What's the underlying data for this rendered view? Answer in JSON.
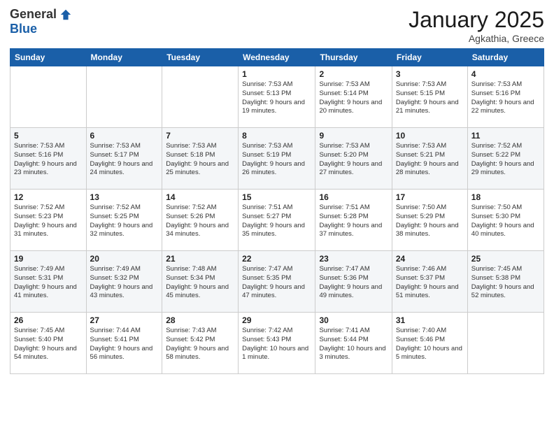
{
  "header": {
    "logo_general": "General",
    "logo_blue": "Blue",
    "month": "January 2025",
    "location": "Agkathia, Greece"
  },
  "weekdays": [
    "Sunday",
    "Monday",
    "Tuesday",
    "Wednesday",
    "Thursday",
    "Friday",
    "Saturday"
  ],
  "weeks": [
    [
      {
        "day": "",
        "detail": ""
      },
      {
        "day": "",
        "detail": ""
      },
      {
        "day": "",
        "detail": ""
      },
      {
        "day": "1",
        "detail": "Sunrise: 7:53 AM\nSunset: 5:13 PM\nDaylight: 9 hours\nand 19 minutes."
      },
      {
        "day": "2",
        "detail": "Sunrise: 7:53 AM\nSunset: 5:14 PM\nDaylight: 9 hours\nand 20 minutes."
      },
      {
        "day": "3",
        "detail": "Sunrise: 7:53 AM\nSunset: 5:15 PM\nDaylight: 9 hours\nand 21 minutes."
      },
      {
        "day": "4",
        "detail": "Sunrise: 7:53 AM\nSunset: 5:16 PM\nDaylight: 9 hours\nand 22 minutes."
      }
    ],
    [
      {
        "day": "5",
        "detail": "Sunrise: 7:53 AM\nSunset: 5:16 PM\nDaylight: 9 hours\nand 23 minutes."
      },
      {
        "day": "6",
        "detail": "Sunrise: 7:53 AM\nSunset: 5:17 PM\nDaylight: 9 hours\nand 24 minutes."
      },
      {
        "day": "7",
        "detail": "Sunrise: 7:53 AM\nSunset: 5:18 PM\nDaylight: 9 hours\nand 25 minutes."
      },
      {
        "day": "8",
        "detail": "Sunrise: 7:53 AM\nSunset: 5:19 PM\nDaylight: 9 hours\nand 26 minutes."
      },
      {
        "day": "9",
        "detail": "Sunrise: 7:53 AM\nSunset: 5:20 PM\nDaylight: 9 hours\nand 27 minutes."
      },
      {
        "day": "10",
        "detail": "Sunrise: 7:53 AM\nSunset: 5:21 PM\nDaylight: 9 hours\nand 28 minutes."
      },
      {
        "day": "11",
        "detail": "Sunrise: 7:52 AM\nSunset: 5:22 PM\nDaylight: 9 hours\nand 29 minutes."
      }
    ],
    [
      {
        "day": "12",
        "detail": "Sunrise: 7:52 AM\nSunset: 5:23 PM\nDaylight: 9 hours\nand 31 minutes."
      },
      {
        "day": "13",
        "detail": "Sunrise: 7:52 AM\nSunset: 5:25 PM\nDaylight: 9 hours\nand 32 minutes."
      },
      {
        "day": "14",
        "detail": "Sunrise: 7:52 AM\nSunset: 5:26 PM\nDaylight: 9 hours\nand 34 minutes."
      },
      {
        "day": "15",
        "detail": "Sunrise: 7:51 AM\nSunset: 5:27 PM\nDaylight: 9 hours\nand 35 minutes."
      },
      {
        "day": "16",
        "detail": "Sunrise: 7:51 AM\nSunset: 5:28 PM\nDaylight: 9 hours\nand 37 minutes."
      },
      {
        "day": "17",
        "detail": "Sunrise: 7:50 AM\nSunset: 5:29 PM\nDaylight: 9 hours\nand 38 minutes."
      },
      {
        "day": "18",
        "detail": "Sunrise: 7:50 AM\nSunset: 5:30 PM\nDaylight: 9 hours\nand 40 minutes."
      }
    ],
    [
      {
        "day": "19",
        "detail": "Sunrise: 7:49 AM\nSunset: 5:31 PM\nDaylight: 9 hours\nand 41 minutes."
      },
      {
        "day": "20",
        "detail": "Sunrise: 7:49 AM\nSunset: 5:32 PM\nDaylight: 9 hours\nand 43 minutes."
      },
      {
        "day": "21",
        "detail": "Sunrise: 7:48 AM\nSunset: 5:34 PM\nDaylight: 9 hours\nand 45 minutes."
      },
      {
        "day": "22",
        "detail": "Sunrise: 7:47 AM\nSunset: 5:35 PM\nDaylight: 9 hours\nand 47 minutes."
      },
      {
        "day": "23",
        "detail": "Sunrise: 7:47 AM\nSunset: 5:36 PM\nDaylight: 9 hours\nand 49 minutes."
      },
      {
        "day": "24",
        "detail": "Sunrise: 7:46 AM\nSunset: 5:37 PM\nDaylight: 9 hours\nand 51 minutes."
      },
      {
        "day": "25",
        "detail": "Sunrise: 7:45 AM\nSunset: 5:38 PM\nDaylight: 9 hours\nand 52 minutes."
      }
    ],
    [
      {
        "day": "26",
        "detail": "Sunrise: 7:45 AM\nSunset: 5:40 PM\nDaylight: 9 hours\nand 54 minutes."
      },
      {
        "day": "27",
        "detail": "Sunrise: 7:44 AM\nSunset: 5:41 PM\nDaylight: 9 hours\nand 56 minutes."
      },
      {
        "day": "28",
        "detail": "Sunrise: 7:43 AM\nSunset: 5:42 PM\nDaylight: 9 hours\nand 58 minutes."
      },
      {
        "day": "29",
        "detail": "Sunrise: 7:42 AM\nSunset: 5:43 PM\nDaylight: 10 hours\nand 1 minute."
      },
      {
        "day": "30",
        "detail": "Sunrise: 7:41 AM\nSunset: 5:44 PM\nDaylight: 10 hours\nand 3 minutes."
      },
      {
        "day": "31",
        "detail": "Sunrise: 7:40 AM\nSunset: 5:46 PM\nDaylight: 10 hours\nand 5 minutes."
      },
      {
        "day": "",
        "detail": ""
      }
    ]
  ]
}
